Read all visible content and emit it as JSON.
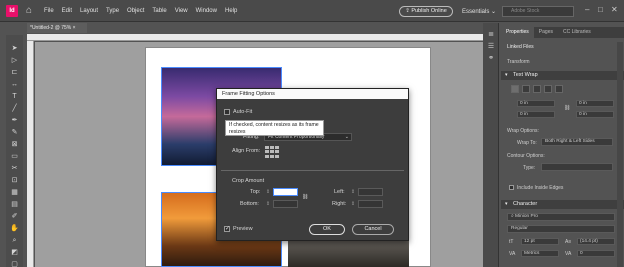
{
  "app": {
    "logo_text": "Id",
    "home_icon": "home-icon"
  },
  "menu": [
    "File",
    "Edit",
    "Layout",
    "Type",
    "Object",
    "Table",
    "View",
    "Window",
    "Help"
  ],
  "header": {
    "publish_label": "Publish Online",
    "workspace_label": "Essentials",
    "stock_placeholder": "Adobe Stock"
  },
  "document": {
    "tab_label": "*Untitled-2 @ 75%"
  },
  "dialog": {
    "title": "Frame Fitting Options",
    "autofit_label": "Auto-Fit",
    "autofit_checked": false,
    "tooltip": "If checked, content resizes as its frame resizes",
    "fitting_label": "Fitting:",
    "fitting_value": "Fit Content Proportionally",
    "align_from_label": "Align From:",
    "crop_amount_label": "Crop Amount",
    "top_label": "Top:",
    "top_value": "",
    "bottom_label": "Bottom:",
    "bottom_value": "",
    "left_label": "Left:",
    "left_value": "",
    "right_label": "Right:",
    "right_value": "",
    "preview_label": "Preview",
    "preview_checked": true,
    "ok_label": "OK",
    "cancel_label": "Cancel"
  },
  "right_panel": {
    "tabs": [
      "Properties",
      "Pages",
      "CC Libraries"
    ],
    "linked_files_label": "Linked Files",
    "transform_label": "Transform",
    "text_wrap": {
      "title": "Text Wrap",
      "top": "0 in",
      "bottom": "0 in",
      "left": "0 in",
      "right": "0 in",
      "wrap_options_label": "Wrap Options:",
      "wrap_to_label": "Wrap To:",
      "wrap_to_value": "Both Right & Left Sides",
      "contour_options_label": "Contour Options:",
      "type_label": "Type:",
      "include_inside_edges": "Include Inside Edges"
    },
    "character": {
      "title": "Character",
      "font_family": "Minion Pro",
      "font_style": "Regular",
      "size": "12 pt",
      "leading": "(14.4 pt)",
      "kerning": "Metrics",
      "tracking": "0"
    }
  }
}
